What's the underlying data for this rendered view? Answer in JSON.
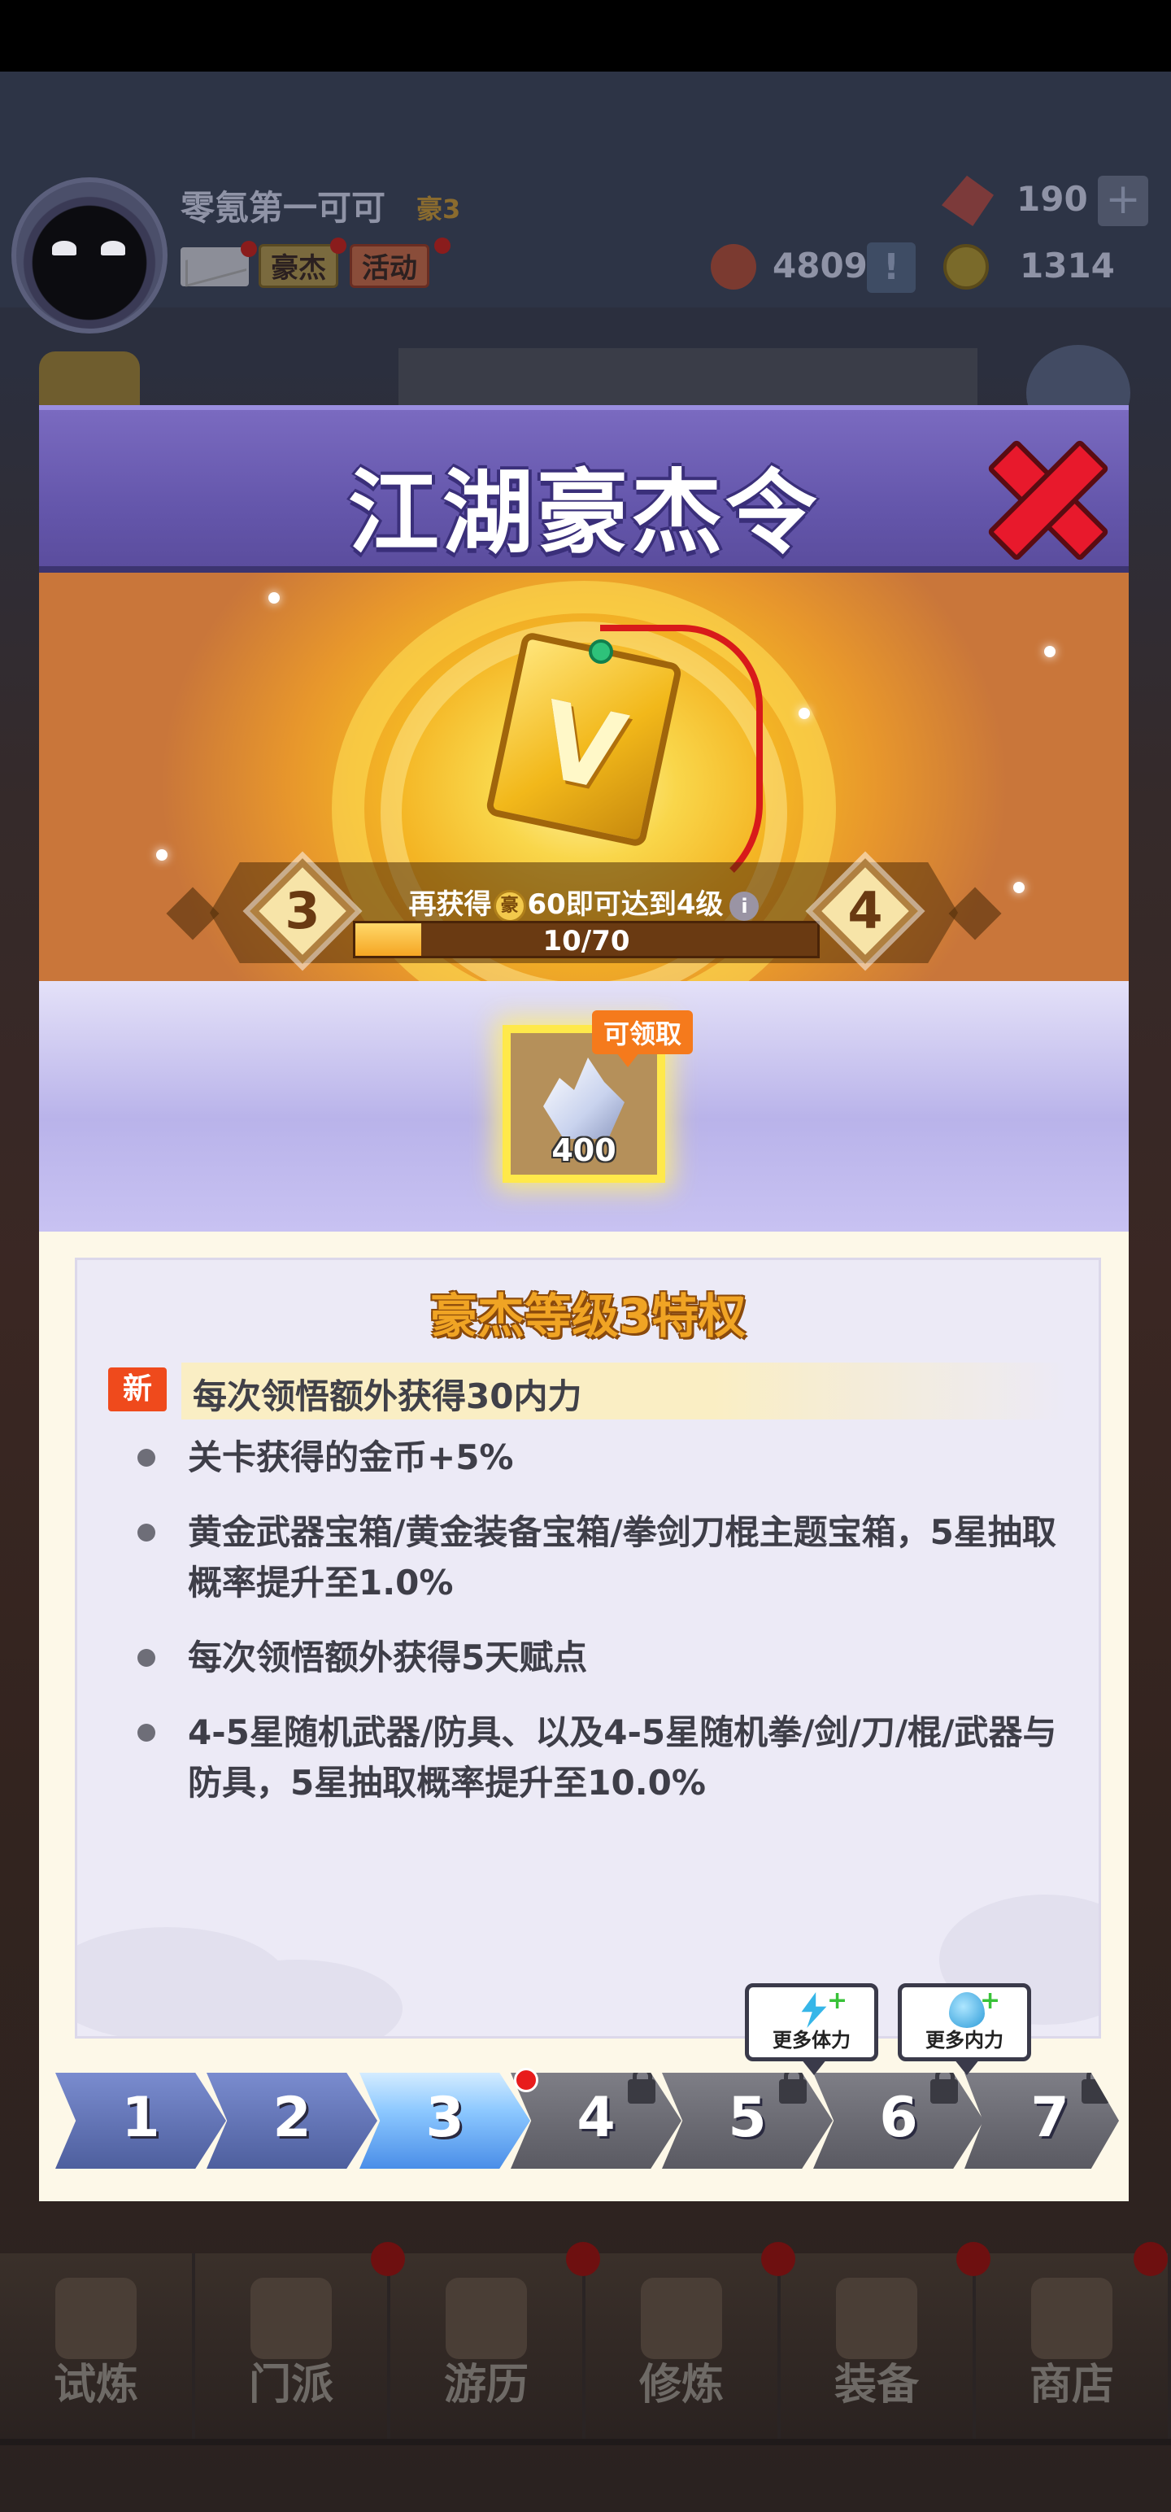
{
  "player": {
    "name": "零氪第一可可",
    "vip_label": "豪3",
    "hero_pill": "豪杰",
    "event_pill": "活动"
  },
  "resources": {
    "gems": "190",
    "medals": "4809",
    "coins": "1314",
    "plus_symbol": "+",
    "alert_symbol": "!"
  },
  "modal": {
    "title": "江湖豪杰令",
    "token_letter": "V",
    "hint_prefix": "再获得",
    "hint_coin_glyph": "豪",
    "hint_suffix": "60即可达到4级",
    "info_symbol": "i",
    "progress_text": "10/70",
    "progress_fraction": 0.143,
    "current_level": "3",
    "next_level": "4"
  },
  "reward": {
    "badge": "可领取",
    "count": "400",
    "icon": "crystal-icon"
  },
  "privileges": {
    "title": "豪杰等级3特权",
    "new_badge": "新",
    "new_item": "每次领悟额外获得30内力",
    "items": [
      "关卡获得的金币+5%",
      "黄金武器宝箱/黄金装备宝箱/拳剑刀棍主题宝箱，5星抽取概率提升至1.0%",
      "每次领悟额外获得5天赋点",
      "4-5星随机武器/防具、以及4-5星随机拳/剑/刀/棍/武器与防具，5星抽取概率提升至10.0%"
    ]
  },
  "tabs": {
    "levels": [
      "1",
      "2",
      "3",
      "4",
      "5",
      "6",
      "7"
    ],
    "tip_stamina": "更多体力",
    "tip_inner": "更多内力"
  },
  "bottom_nav": [
    "试炼",
    "门派",
    "游历",
    "修炼",
    "装备",
    "商店"
  ]
}
